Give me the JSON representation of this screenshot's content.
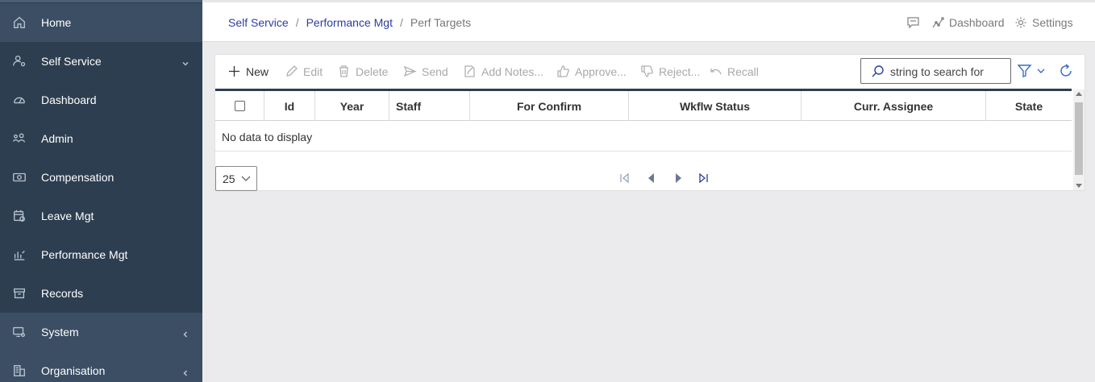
{
  "sidebar": {
    "items": [
      {
        "label": "Home",
        "icon": "home-icon",
        "chevron": ""
      },
      {
        "label": "Self Service",
        "icon": "user-gear-icon",
        "chevron": "down"
      },
      {
        "label": "Dashboard",
        "icon": "gauge-icon",
        "chevron": ""
      },
      {
        "label": "Admin",
        "icon": "people-admin-icon",
        "chevron": ""
      },
      {
        "label": "Compensation",
        "icon": "cash-icon",
        "chevron": ""
      },
      {
        "label": "Leave Mgt",
        "icon": "calendar-clock-icon",
        "chevron": ""
      },
      {
        "label": "Performance Mgt",
        "icon": "chart-hand-icon",
        "chevron": ""
      },
      {
        "label": "Records",
        "icon": "archive-box-icon",
        "chevron": ""
      },
      {
        "label": "System",
        "icon": "monitor-gear-icon",
        "chevron": "left"
      },
      {
        "label": "Organisation",
        "icon": "building-icon",
        "chevron": "left"
      }
    ]
  },
  "breadcrumb": {
    "items": [
      "Self Service",
      "Performance Mgt"
    ],
    "current": "Perf Targets",
    "separator": "/"
  },
  "topbar": {
    "dashboard_label": "Dashboard",
    "settings_label": "Settings"
  },
  "toolbar": {
    "new_label": "New",
    "edit_label": "Edit",
    "delete_label": "Delete",
    "send_label": "Send",
    "add_notes_label": "Add Notes...",
    "approve_label": "Approve...",
    "reject_label": "Reject...",
    "recall_label": "Recall",
    "search_placeholder": "string to search for"
  },
  "table": {
    "columns": [
      "Id",
      "Year",
      "Staff",
      "For Confirm",
      "Wkflw Status",
      "Curr. Assignee",
      "State"
    ],
    "empty_text": "No data to display"
  },
  "pager": {
    "page_size": "25"
  },
  "colors": {
    "sidebar_bg": "#2d3e50",
    "link": "#2c3e9f",
    "accent_icon": "#3b6fbf"
  }
}
